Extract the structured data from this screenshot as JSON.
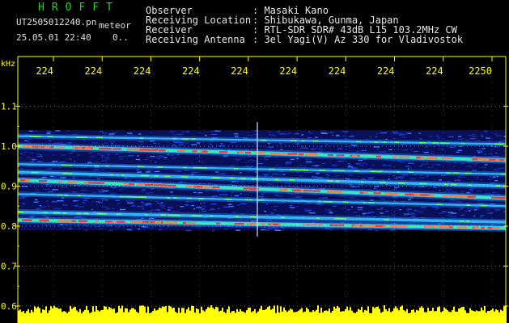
{
  "header": {
    "logo": "HROFFT",
    "filename": "UT2505012240.pn",
    "tag": "meteor",
    "datetime": "25.05.01 22:40",
    "count": "0..",
    "info": [
      {
        "label": "Observer",
        "value": ": Masaki Kano"
      },
      {
        "label": "Receiving Location",
        "value": ": Shibukawa, Gunma, Japan"
      },
      {
        "label": "Receiver",
        "value": ": RTL-SDR SDR# 43dB L15 103.2MHz CW"
      },
      {
        "label": "Receiving Antenna",
        "value": ": 3el Yagi(V) Az 330 for Vladivostok"
      }
    ]
  },
  "chart_data": {
    "type": "heatmap",
    "ylabel": "kHz",
    "x_tick_labels": [
      "224",
      "224",
      "224",
      "224",
      "224",
      "224",
      "224",
      "224",
      "224",
      "2250"
    ],
    "y_ticks": [
      0.6,
      0.7,
      0.8,
      0.9,
      1.0,
      1.1
    ],
    "y_tick_labels": [
      "0.6",
      "0.7",
      "0.8",
      "0.9",
      "1.0",
      "1.1"
    ],
    "ylim": [
      0.6,
      1.15
    ],
    "noise_band": [
      0.79,
      1.04
    ],
    "traces": [
      {
        "start": 0.915,
        "end": 0.87,
        "intensity": "strong"
      },
      {
        "start": 0.815,
        "end": 0.795,
        "intensity": "strong"
      },
      {
        "start": 1.0,
        "end": 0.965,
        "intensity": "strong"
      },
      {
        "start": 0.935,
        "end": 0.9,
        "intensity": "medium"
      },
      {
        "start": 0.955,
        "end": 0.93,
        "intensity": "weak"
      },
      {
        "start": 1.025,
        "end": 1.005,
        "intensity": "weak"
      },
      {
        "start": 0.835,
        "end": 0.81,
        "intensity": "medium"
      },
      {
        "start": 0.88,
        "end": 0.85,
        "intensity": "weak"
      }
    ],
    "colors": {
      "background": "#000000",
      "axis": "#ffff00",
      "grid": "#ffffff",
      "noise": "#1e32c8",
      "trace": "#3cc8ff",
      "peak": "#ff3030",
      "bar": "#ffff00"
    }
  }
}
